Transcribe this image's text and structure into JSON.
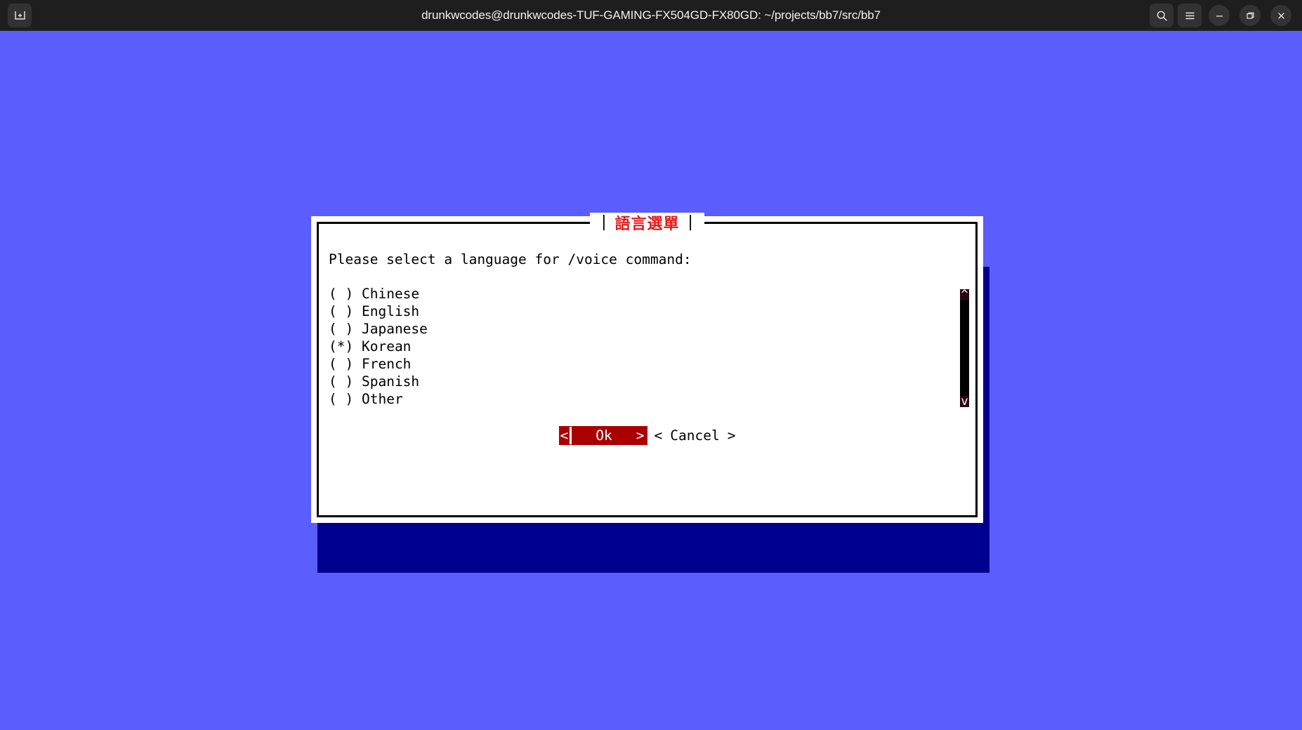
{
  "window": {
    "title": "drunkwcodes@drunkwcodes-TUF-GAMING-FX504GD-FX80GD: ~/projects/bb7/src/bb7",
    "background_color": "#1e1e1e",
    "left_buttons": [
      {
        "name": "new-tab-icon",
        "glyph": "⊞"
      }
    ],
    "right_buttons": [
      {
        "name": "search-icon",
        "glyph": "⌕"
      },
      {
        "name": "hamburger-menu-icon",
        "glyph": "☰"
      },
      {
        "name": "minimize-button",
        "glyph": "−"
      },
      {
        "name": "maximize-button",
        "glyph": "❐"
      },
      {
        "name": "close-button",
        "glyph": "✕"
      }
    ]
  },
  "terminal": {
    "background_color": "#5b5dfd",
    "shadow_color": "#00008f"
  },
  "dialog": {
    "title": "語言選單",
    "title_color": "#e01b1b",
    "title_left_pipe": "|",
    "title_right_pipe": "|",
    "prompt": "Please select a language for /voice command:",
    "options": [
      {
        "marker": "( )",
        "label": "Chinese",
        "selected": false
      },
      {
        "marker": "( )",
        "label": "English",
        "selected": false
      },
      {
        "marker": "( )",
        "label": "Japanese",
        "selected": false
      },
      {
        "marker": "(*)",
        "label": "Korean",
        "selected": true
      },
      {
        "marker": "( )",
        "label": "French",
        "selected": false
      },
      {
        "marker": "( )",
        "label": "Spanish",
        "selected": false
      },
      {
        "marker": "( )",
        "label": "Other",
        "selected": false
      }
    ],
    "scrollbar": {
      "up_arrow": "^",
      "down_arrow": "v",
      "track_color": "#2b0713",
      "thumb_color": "#000000"
    },
    "buttons": {
      "ok": {
        "label": "Ok",
        "left_bracket": "<",
        "right_bracket": ">",
        "focused": true,
        "focus_bg": "#aa0000",
        "focus_fg": "#ffffff"
      },
      "cancel": {
        "label": "Cancel",
        "left_bracket": "<",
        "right_bracket": ">",
        "focused": false
      }
    }
  }
}
